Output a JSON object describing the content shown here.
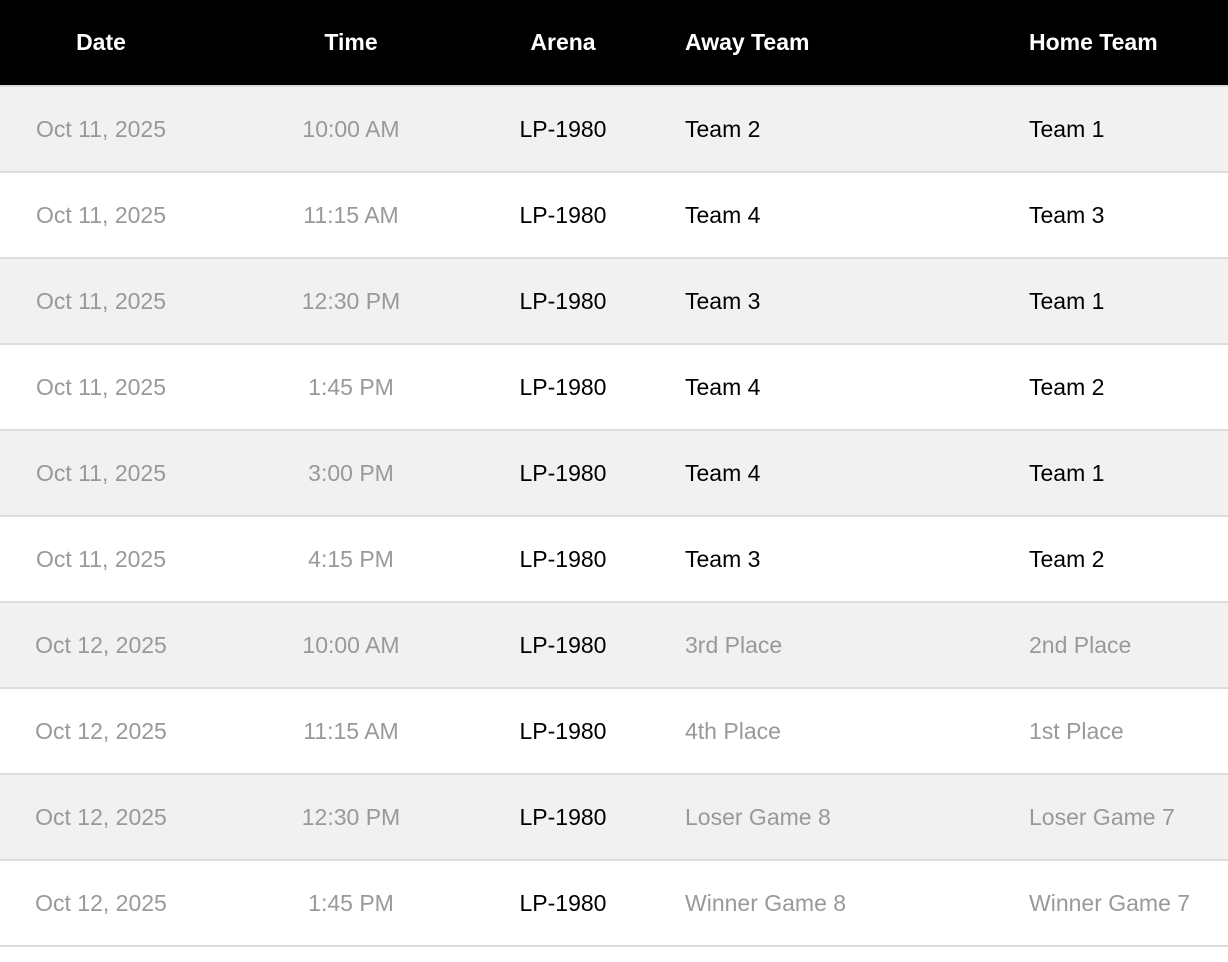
{
  "headers": {
    "date": "Date",
    "time": "Time",
    "arena": "Arena",
    "away": "Away Team",
    "home": "Home Team"
  },
  "rows": [
    {
      "date": "Oct 11, 2025",
      "time": "10:00 AM",
      "arena": "LP-1980",
      "away": "Team 2",
      "home": "Team 1",
      "confirmed": true
    },
    {
      "date": "Oct 11, 2025",
      "time": "11:15 AM",
      "arena": "LP-1980",
      "away": "Team 4",
      "home": "Team 3",
      "confirmed": true
    },
    {
      "date": "Oct 11, 2025",
      "time": "12:30 PM",
      "arena": "LP-1980",
      "away": "Team 3",
      "home": "Team 1",
      "confirmed": true
    },
    {
      "date": "Oct 11, 2025",
      "time": "1:45 PM",
      "arena": "LP-1980",
      "away": "Team 4",
      "home": "Team 2",
      "confirmed": true
    },
    {
      "date": "Oct 11, 2025",
      "time": "3:00 PM",
      "arena": "LP-1980",
      "away": "Team 4",
      "home": "Team 1",
      "confirmed": true
    },
    {
      "date": "Oct 11, 2025",
      "time": "4:15 PM",
      "arena": "LP-1980",
      "away": "Team 3",
      "home": "Team 2",
      "confirmed": true
    },
    {
      "date": "Oct 12, 2025",
      "time": "10:00 AM",
      "arena": "LP-1980",
      "away": "3rd Place",
      "home": "2nd Place",
      "confirmed": false
    },
    {
      "date": "Oct 12, 2025",
      "time": "11:15 AM",
      "arena": "LP-1980",
      "away": "4th Place",
      "home": "1st Place",
      "confirmed": false
    },
    {
      "date": "Oct 12, 2025",
      "time": "12:30 PM",
      "arena": "LP-1980",
      "away": "Loser Game 8",
      "home": "Loser Game 7",
      "confirmed": false
    },
    {
      "date": "Oct 12, 2025",
      "time": "1:45 PM",
      "arena": "LP-1980",
      "away": "Winner Game 8",
      "home": "Winner Game 7",
      "confirmed": false
    }
  ],
  "colors": {
    "header_bg": "#000000",
    "header_text": "#ffffff",
    "row_alt_bg": "#f1f1f1",
    "muted_text": "#999999",
    "primary_text": "#000000"
  }
}
